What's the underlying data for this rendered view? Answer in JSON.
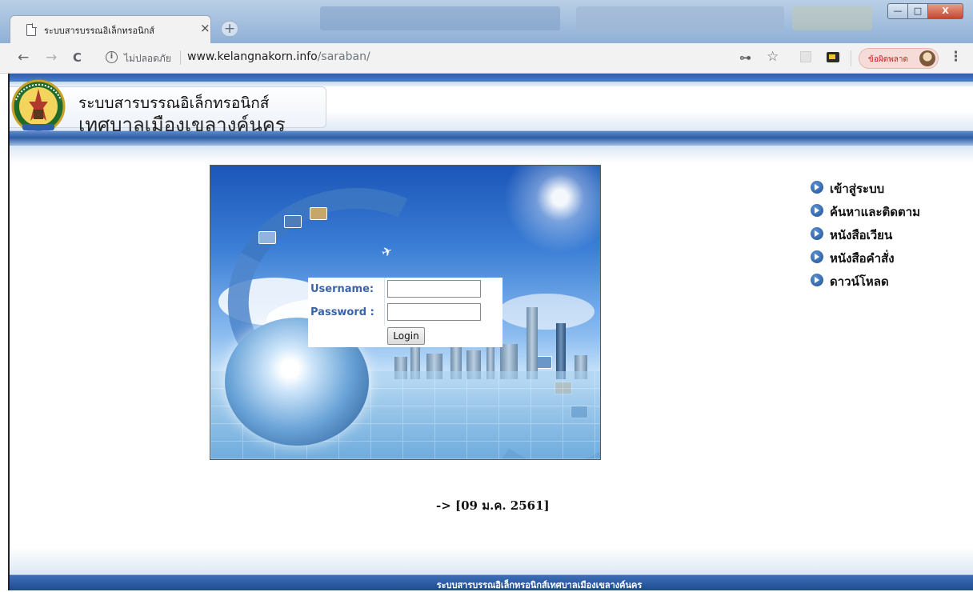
{
  "browser": {
    "tab_title": "ระบบสารบรรณอิเล็กทรอนิกส์",
    "tab_close": "×",
    "new_tab": "+",
    "nav": {
      "back": "←",
      "forward": "→",
      "reload": "C"
    },
    "omnibox": {
      "info_icon": "i",
      "security_text": "ไม่ปลอดภัย",
      "url_host": "www.kelangnakorn.info",
      "url_path": "/saraban/"
    },
    "icons": {
      "key": "⊶",
      "star": "☆",
      "menu": "⋮"
    },
    "error_button_label": "ข้อผิดพลาด",
    "window_controls": {
      "minimize": "—",
      "maximize": "□",
      "close": "X"
    }
  },
  "header": {
    "line1": "ระบบสารบรรณอิเล็กทรอนิกส์",
    "line2": "เทศบาลเมืองเขลางค์นคร"
  },
  "login": {
    "username_label": "Username:",
    "password_label": "Password :",
    "username_value": "",
    "password_value": "",
    "submit_label": "Login"
  },
  "menu": [
    {
      "label": "เข้าสู่ระบบ"
    },
    {
      "label": "ค้นหาและติดตาม"
    },
    {
      "label": "หนังสือเวียน"
    },
    {
      "label": "หนังสือคำสั่ง"
    },
    {
      "label": "ดาวน์โหลด"
    }
  ],
  "date_text": "-> [09 ม.ค. 2561]",
  "footer_text": "ระบบสารบรรณอิเล็กทรอนิกส์เทศบาลเมืองเขลางค์นคร",
  "colors": {
    "accent_blue": "#2f5ea6",
    "label_blue": "#3b64a8",
    "error_red": "#c5221f"
  }
}
